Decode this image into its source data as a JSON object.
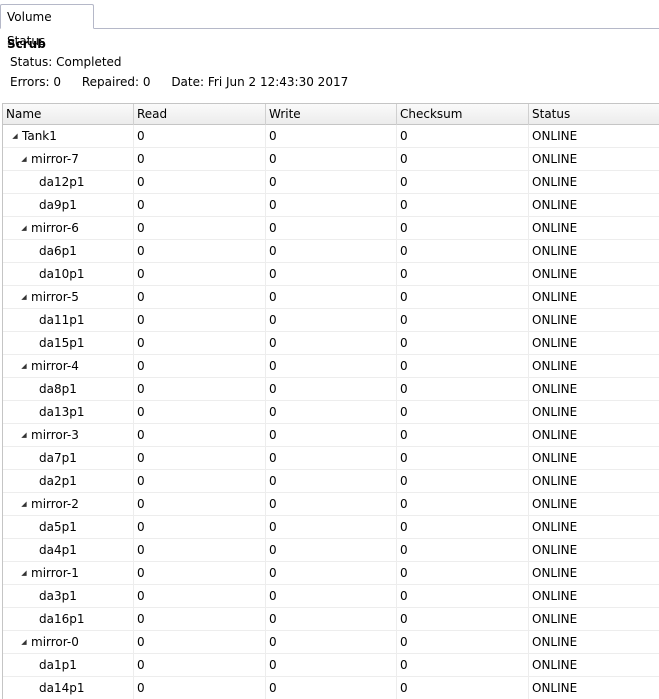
{
  "tab": {
    "label": "Volume Status"
  },
  "scrub": {
    "title": "Scrub",
    "status": "Status: Completed",
    "errors": "Errors: 0",
    "repaired": "Repaired: 0",
    "date": "Date: Fri Jun 2 12:43:30 2017"
  },
  "grid": {
    "columns": [
      "Name",
      "Read",
      "Write",
      "Checksum",
      "Status"
    ],
    "rows": [
      {
        "name": "Tank1",
        "level": 0,
        "expanded": true,
        "read": "0",
        "write": "0",
        "checksum": "0",
        "status": "ONLINE"
      },
      {
        "name": "mirror-7",
        "level": 1,
        "expanded": true,
        "read": "0",
        "write": "0",
        "checksum": "0",
        "status": "ONLINE"
      },
      {
        "name": "da12p1",
        "level": 2,
        "read": "0",
        "write": "0",
        "checksum": "0",
        "status": "ONLINE"
      },
      {
        "name": "da9p1",
        "level": 2,
        "read": "0",
        "write": "0",
        "checksum": "0",
        "status": "ONLINE"
      },
      {
        "name": "mirror-6",
        "level": 1,
        "expanded": true,
        "read": "0",
        "write": "0",
        "checksum": "0",
        "status": "ONLINE"
      },
      {
        "name": "da6p1",
        "level": 2,
        "read": "0",
        "write": "0",
        "checksum": "0",
        "status": "ONLINE"
      },
      {
        "name": "da10p1",
        "level": 2,
        "read": "0",
        "write": "0",
        "checksum": "0",
        "status": "ONLINE"
      },
      {
        "name": "mirror-5",
        "level": 1,
        "expanded": true,
        "read": "0",
        "write": "0",
        "checksum": "0",
        "status": "ONLINE"
      },
      {
        "name": "da11p1",
        "level": 2,
        "read": "0",
        "write": "0",
        "checksum": "0",
        "status": "ONLINE"
      },
      {
        "name": "da15p1",
        "level": 2,
        "read": "0",
        "write": "0",
        "checksum": "0",
        "status": "ONLINE"
      },
      {
        "name": "mirror-4",
        "level": 1,
        "expanded": true,
        "read": "0",
        "write": "0",
        "checksum": "0",
        "status": "ONLINE"
      },
      {
        "name": "da8p1",
        "level": 2,
        "read": "0",
        "write": "0",
        "checksum": "0",
        "status": "ONLINE"
      },
      {
        "name": "da13p1",
        "level": 2,
        "read": "0",
        "write": "0",
        "checksum": "0",
        "status": "ONLINE"
      },
      {
        "name": "mirror-3",
        "level": 1,
        "expanded": true,
        "read": "0",
        "write": "0",
        "checksum": "0",
        "status": "ONLINE"
      },
      {
        "name": "da7p1",
        "level": 2,
        "read": "0",
        "write": "0",
        "checksum": "0",
        "status": "ONLINE"
      },
      {
        "name": "da2p1",
        "level": 2,
        "read": "0",
        "write": "0",
        "checksum": "0",
        "status": "ONLINE"
      },
      {
        "name": "mirror-2",
        "level": 1,
        "expanded": true,
        "read": "0",
        "write": "0",
        "checksum": "0",
        "status": "ONLINE"
      },
      {
        "name": "da5p1",
        "level": 2,
        "read": "0",
        "write": "0",
        "checksum": "0",
        "status": "ONLINE"
      },
      {
        "name": "da4p1",
        "level": 2,
        "read": "0",
        "write": "0",
        "checksum": "0",
        "status": "ONLINE"
      },
      {
        "name": "mirror-1",
        "level": 1,
        "expanded": true,
        "read": "0",
        "write": "0",
        "checksum": "0",
        "status": "ONLINE"
      },
      {
        "name": "da3p1",
        "level": 2,
        "read": "0",
        "write": "0",
        "checksum": "0",
        "status": "ONLINE"
      },
      {
        "name": "da16p1",
        "level": 2,
        "read": "0",
        "write": "0",
        "checksum": "0",
        "status": "ONLINE"
      },
      {
        "name": "mirror-0",
        "level": 1,
        "expanded": true,
        "read": "0",
        "write": "0",
        "checksum": "0",
        "status": "ONLINE"
      },
      {
        "name": "da1p1",
        "level": 2,
        "read": "0",
        "write": "0",
        "checksum": "0",
        "status": "ONLINE"
      },
      {
        "name": "da14p1",
        "level": 2,
        "read": "0",
        "write": "0",
        "checksum": "0",
        "status": "ONLINE"
      }
    ]
  }
}
